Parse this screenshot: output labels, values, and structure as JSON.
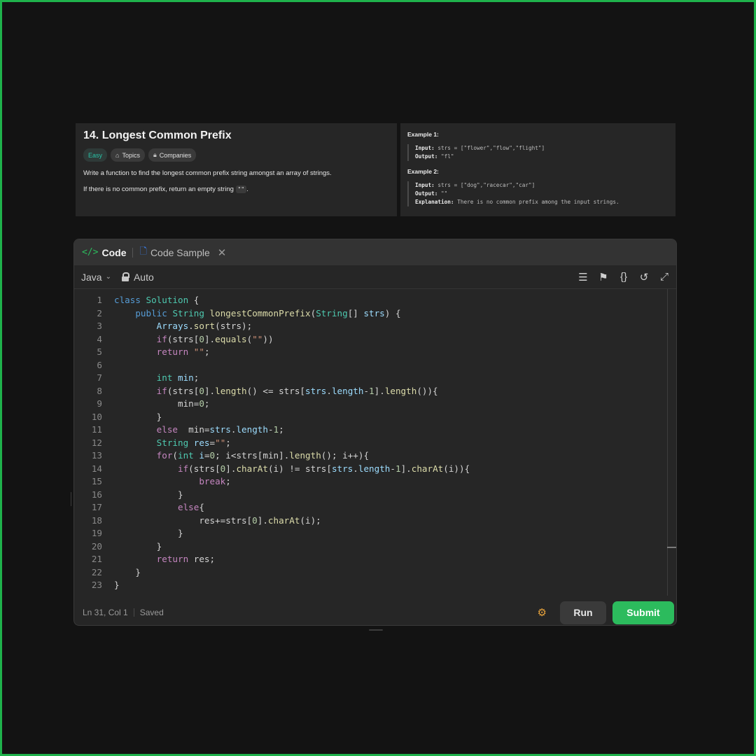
{
  "problem": {
    "title": "14. Longest Common Prefix",
    "tags": {
      "difficulty": "Easy",
      "topics": "Topics",
      "companies": "Companies"
    },
    "desc1": "Write a function to find the longest common prefix string amongst an array of strings.",
    "desc2_pre": "If there is no common prefix, return an empty string ",
    "desc2_code": "\"\"",
    "desc2_post": "."
  },
  "examples": {
    "ex1_title": "Example 1:",
    "ex1_input_label": "Input:",
    "ex1_input": "strs = [\"flower\",\"flow\",\"flight\"]",
    "ex1_output_label": "Output:",
    "ex1_output": "\"fl\"",
    "ex2_title": "Example 2:",
    "ex2_input_label": "Input:",
    "ex2_input": "strs = [\"dog\",\"racecar\",\"car\"]",
    "ex2_output_label": "Output:",
    "ex2_output": "\"\"",
    "ex2_expl_label": "Explanation:",
    "ex2_expl": "There is no common prefix among the input strings."
  },
  "editor": {
    "tab_code": "Code",
    "tab_sample": "Code Sample",
    "language": "Java",
    "mode": "Auto",
    "line_numbers": [
      "1",
      "2",
      "3",
      "4",
      "5",
      "6",
      "7",
      "8",
      "9",
      "10",
      "11",
      "12",
      "13",
      "14",
      "15",
      "16",
      "17",
      "18",
      "19",
      "20",
      "21",
      "22",
      "23"
    ]
  },
  "status": {
    "position": "Ln 31, Col 1",
    "saved": "Saved",
    "run_label": "Run",
    "submit_label": "Submit"
  },
  "colors": {
    "accent": "#2cbb5d",
    "easy": "#28c2a6"
  },
  "icons": [
    "code-icon",
    "file-icon",
    "close-icon",
    "chevron-down-icon",
    "lock-icon",
    "format-icon",
    "bookmark-icon",
    "braces-icon",
    "reset-icon",
    "expand-icon",
    "debug-icon"
  ]
}
